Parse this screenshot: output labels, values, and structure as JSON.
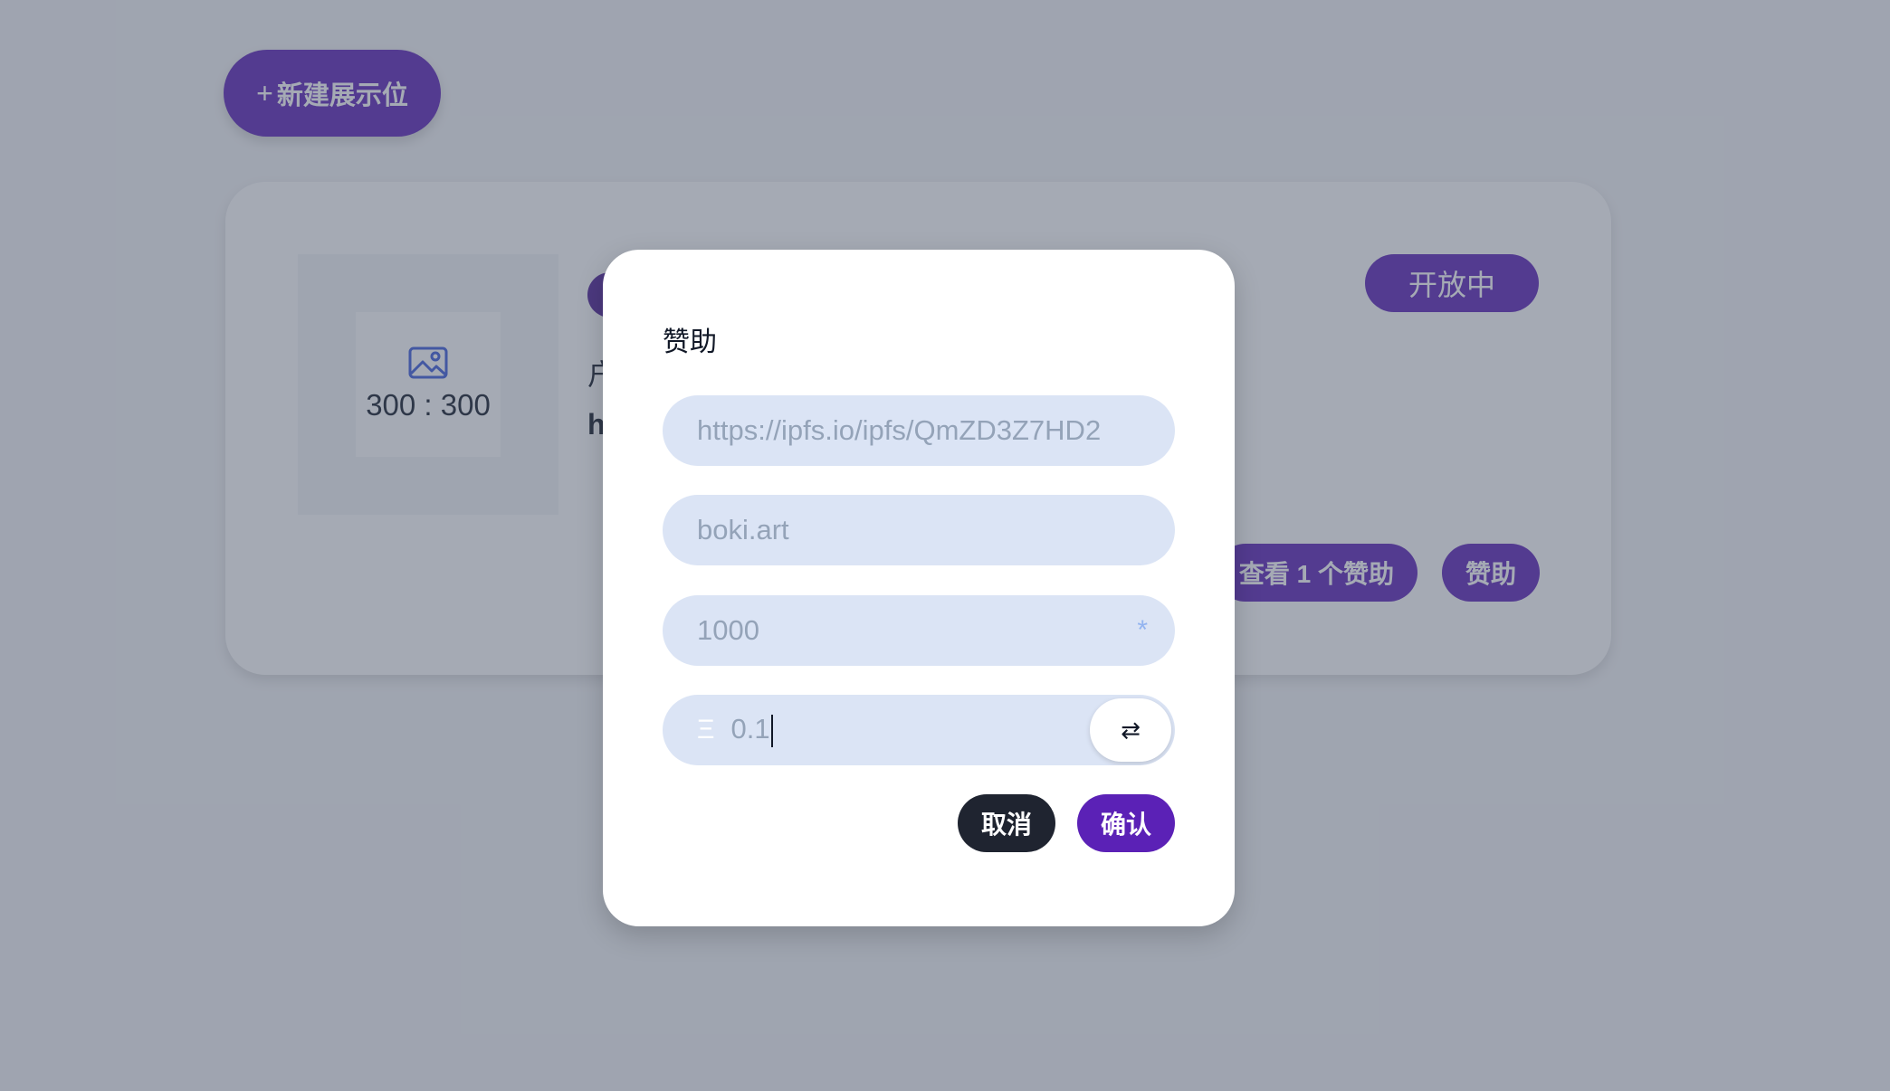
{
  "toolbar": {
    "new_slot_icon": "+",
    "new_slot_label": "新建展示位"
  },
  "slot_card": {
    "preview": {
      "icon": "image-icon",
      "ratio_text": "300 : 300"
    },
    "line_a": "户",
    "line_b": "h",
    "status_badge": "开放中",
    "view_sponsors_label": "查看 1 个赞助",
    "sponsor_label": "赞助"
  },
  "modal": {
    "title": "赞助",
    "image_url_value": "https://ipfs.io/ipfs/QmZD3Z7HD2",
    "link_value": "boki.art",
    "amount_value": "1000",
    "required_mark": "*",
    "eth_symbol": "Ξ",
    "eth_value": "0.1",
    "swap_icon": "⇄",
    "cancel_label": "取消",
    "confirm_label": "确认"
  },
  "colors": {
    "primary": "#5b21b6",
    "dark_button": "#1f2430",
    "input_bg": "#dbe4f5",
    "overlay": "rgba(75,85,106,0.5)"
  }
}
